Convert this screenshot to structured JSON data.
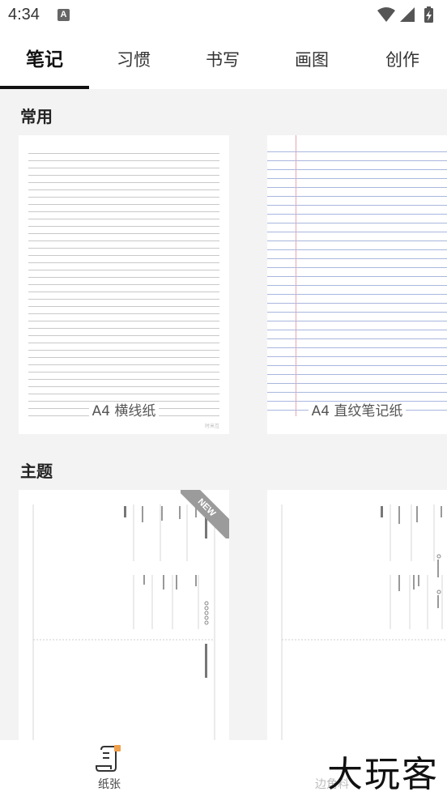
{
  "status_bar": {
    "time": "4:34",
    "notification_icon": "A"
  },
  "tabs": [
    {
      "label": "笔记",
      "active": true
    },
    {
      "label": "习惯",
      "active": false
    },
    {
      "label": "书写",
      "active": false
    },
    {
      "label": "画图",
      "active": false
    },
    {
      "label": "创作",
      "active": false
    }
  ],
  "sections": {
    "common": {
      "title": "常用",
      "cards": [
        {
          "label": "A4 横线纸",
          "footnote": "时米互"
        },
        {
          "label": "A4 直纹笔记纸"
        }
      ]
    },
    "theme": {
      "title": "主题",
      "badge": "NEW"
    }
  },
  "bottom_nav": {
    "paper_label": "纸张",
    "second_label": "边角料",
    "watermark": "大玩客"
  },
  "colors": {
    "accent": "#111111",
    "ruled_line": "#c9c9c9",
    "blue_line": "#a9b7df",
    "margin_line": "#e5a6b4",
    "badge": "#9b9b9b"
  }
}
